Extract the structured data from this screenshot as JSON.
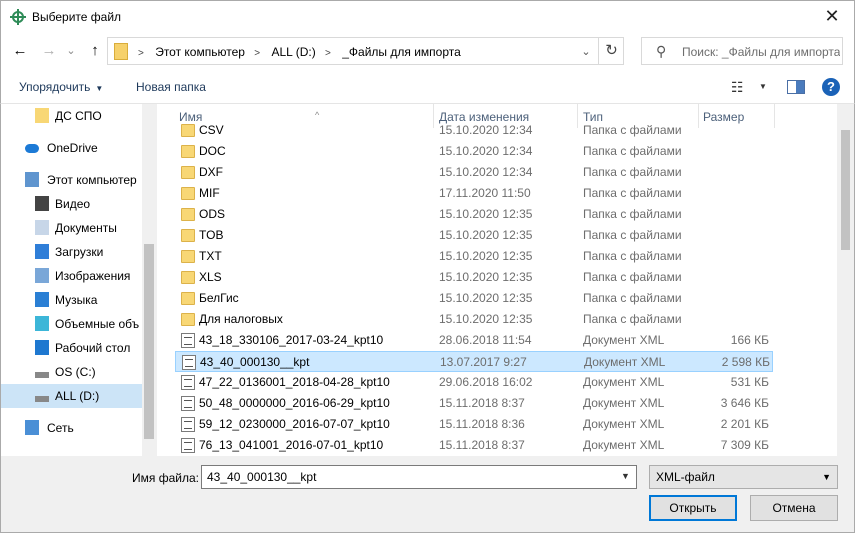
{
  "window": {
    "title": "Выберите файл",
    "close_glyph": "✕"
  },
  "nav": {
    "back_glyph": "←",
    "forward_glyph": "→",
    "recent_glyph": "⌄",
    "up_glyph": "↑",
    "breadcrumb": [
      "Этот компьютер",
      "ALL (D:)",
      "_Файлы для импорта"
    ],
    "chevron": ">",
    "refresh_glyph": "↻",
    "search_placeholder": "Поиск: _Файлы для импорта"
  },
  "toolbar": {
    "organize_label": "Упорядочить",
    "new_folder_label": "Новая папка",
    "help_label": "?"
  },
  "sidebar": {
    "items": [
      {
        "label": "ДС СПО",
        "icon": "folder-icon"
      },
      {
        "label": "OneDrive",
        "icon": "cloud-icon"
      },
      {
        "label": "Этот компьютер",
        "icon": "computer-icon"
      },
      {
        "label": "Видео",
        "icon": "video-icon"
      },
      {
        "label": "Документы",
        "icon": "documents-icon"
      },
      {
        "label": "Загрузки",
        "icon": "download-icon"
      },
      {
        "label": "Изображения",
        "icon": "pictures-icon"
      },
      {
        "label": "Музыка",
        "icon": "music-icon"
      },
      {
        "label": "Объемные объ",
        "icon": "3d-objects-icon"
      },
      {
        "label": "Рабочий стол",
        "icon": "desktop-icon"
      },
      {
        "label": "OS (C:)",
        "icon": "drive-icon"
      },
      {
        "label": "ALL (D:)",
        "icon": "drive-icon"
      },
      {
        "label": "Сеть",
        "icon": "network-icon"
      }
    ]
  },
  "columns": {
    "name": "Имя",
    "date": "Дата изменения",
    "type": "Тип",
    "size": "Размер"
  },
  "files": [
    {
      "name": "CSV",
      "date": "15.10.2020 12:34",
      "type": "Папка с файлами",
      "size": "",
      "kind": "folder"
    },
    {
      "name": "DOC",
      "date": "15.10.2020 12:34",
      "type": "Папка с файлами",
      "size": "",
      "kind": "folder"
    },
    {
      "name": "DXF",
      "date": "15.10.2020 12:34",
      "type": "Папка с файлами",
      "size": "",
      "kind": "folder"
    },
    {
      "name": "MIF",
      "date": "17.11.2020 11:50",
      "type": "Папка с файлами",
      "size": "",
      "kind": "folder"
    },
    {
      "name": "ODS",
      "date": "15.10.2020 12:35",
      "type": "Папка с файлами",
      "size": "",
      "kind": "folder"
    },
    {
      "name": "TOB",
      "date": "15.10.2020 12:35",
      "type": "Папка с файлами",
      "size": "",
      "kind": "folder"
    },
    {
      "name": "TXT",
      "date": "15.10.2020 12:35",
      "type": "Папка с файлами",
      "size": "",
      "kind": "folder"
    },
    {
      "name": "XLS",
      "date": "15.10.2020 12:35",
      "type": "Папка с файлами",
      "size": "",
      "kind": "folder"
    },
    {
      "name": "БелГис",
      "date": "15.10.2020 12:35",
      "type": "Папка с файлами",
      "size": "",
      "kind": "folder"
    },
    {
      "name": "Для налоговых",
      "date": "15.10.2020 12:35",
      "type": "Папка с файлами",
      "size": "",
      "kind": "folder"
    },
    {
      "name": "43_18_330106_2017-03-24_kpt10",
      "date": "28.06.2018 11:54",
      "type": "Документ XML",
      "size": "166 КБ",
      "kind": "xml"
    },
    {
      "name": "43_40_000130__kpt",
      "date": "13.07.2017 9:27",
      "type": "Документ XML",
      "size": "2 598 КБ",
      "kind": "xml"
    },
    {
      "name": "47_22_0136001_2018-04-28_kpt10",
      "date": "29.06.2018 16:02",
      "type": "Документ XML",
      "size": "531 КБ",
      "kind": "xml"
    },
    {
      "name": "50_48_0000000_2016-06-29_kpt10",
      "date": "15.11.2018 8:37",
      "type": "Документ XML",
      "size": "3 646 КБ",
      "kind": "xml"
    },
    {
      "name": "59_12_0230000_2016-07-07_kpt10",
      "date": "15.11.2018 8:36",
      "type": "Документ XML",
      "size": "2 201 КБ",
      "kind": "xml"
    },
    {
      "name": "76_13_041001_2016-07-01_kpt10",
      "date": "15.11.2018 8:37",
      "type": "Документ XML",
      "size": "7 309 КБ",
      "kind": "xml"
    }
  ],
  "footer": {
    "filename_label": "Имя файла:",
    "filename_value": "43_40_000130__kpt",
    "filetype_value": "XML-файл",
    "open_label": "Открыть",
    "cancel_label": "Отмена"
  }
}
